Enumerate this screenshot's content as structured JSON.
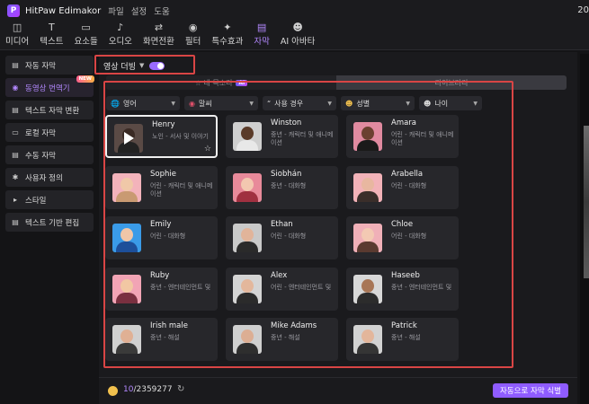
{
  "app": {
    "title": "HitPaw Edimakor",
    "menu": [
      "파일",
      "설정",
      "도움"
    ],
    "corner_text": "20"
  },
  "toolbar": {
    "items": [
      {
        "label": "미디어",
        "icon": "media-icon"
      },
      {
        "label": "텍스트",
        "icon": "text-icon"
      },
      {
        "label": "요소들",
        "icon": "elements-icon"
      },
      {
        "label": "오디오",
        "icon": "audio-icon"
      },
      {
        "label": "화면전환",
        "icon": "transition-icon"
      },
      {
        "label": "필터",
        "icon": "filter-icon"
      },
      {
        "label": "특수효과",
        "icon": "effects-icon"
      },
      {
        "label": "자막",
        "icon": "subtitle-icon"
      },
      {
        "label": "AI 아바타",
        "icon": "avatar-icon"
      }
    ],
    "active_index": 7
  },
  "sidebar": {
    "items": [
      {
        "label": "자동 자막",
        "icon": "cc-icon"
      },
      {
        "label": "동영상 번역기",
        "icon": "translate-icon",
        "badge": "NEW"
      },
      {
        "label": "텍스트 자막 변환",
        "icon": "text-to-subtitle-icon"
      },
      {
        "label": "로컬 자막",
        "icon": "local-subtitle-icon"
      },
      {
        "label": "수동 자막",
        "icon": "manual-subtitle-icon"
      },
      {
        "label": "사용자 정의",
        "icon": "custom-icon"
      },
      {
        "label": "스타일",
        "icon": "caret-right-icon"
      },
      {
        "label": "텍스트 기반 편집",
        "icon": "text-edit-icon"
      }
    ],
    "active_index": 1
  },
  "dubbing": {
    "label": "영상 더빙",
    "enabled": true
  },
  "tabs": {
    "my_voice": "내 목소리",
    "ai_badge": "AI",
    "library": "라이브러리"
  },
  "filters": [
    {
      "label": "영어",
      "icon": "globe-icon"
    },
    {
      "label": "말씨",
      "icon": "lips-icon"
    },
    {
      "label": "사용 경우",
      "icon": "quote-icon"
    },
    {
      "label": "성별",
      "icon": "gender-icon"
    },
    {
      "label": "나이",
      "icon": "age-icon"
    }
  ],
  "voices": [
    {
      "name": "Henry",
      "desc": "노인 - 서사 및 이야기",
      "selected": true,
      "skin": "#3a2a24",
      "bg": "#5a4a45",
      "shirt": "#222"
    },
    {
      "name": "Winston",
      "desc": "중년 - 캐릭터 및 애니메이션",
      "skin": "#5a3a28",
      "bg": "#cfcfcf",
      "shirt": "#e8e8e8"
    },
    {
      "name": "Amara",
      "desc": "어린 - 캐릭터 및 애니메이션",
      "skin": "#6b4030",
      "bg": "#e08aa0",
      "shirt": "#1a1a1a"
    },
    {
      "name": "Sophie",
      "desc": "어린 - 캐릭터 및 애니메이션",
      "skin": "#f0c8a8",
      "bg": "#f3b3bb",
      "shirt": "#c99a72"
    },
    {
      "name": "Siobhán",
      "desc": "중년 - 대화형",
      "skin": "#f3c7b0",
      "bg": "#e88a9a",
      "shirt": "#a03040"
    },
    {
      "name": "Arabella",
      "desc": "어린 - 대화형",
      "skin": "#e8b7a0",
      "bg": "#f2b2b8",
      "shirt": "#3a2e2a"
    },
    {
      "name": "Emily",
      "desc": "어린 - 대화형",
      "skin": "#f0c6a8",
      "bg": "#3a9be8",
      "shirt": "#1d4f9a"
    },
    {
      "name": "Ethan",
      "desc": "어린 - 대화형",
      "skin": "#e1b49a",
      "bg": "#c9c9c9",
      "shirt": "#2a2a2a"
    },
    {
      "name": "Chloe",
      "desc": "어린 - 대화형",
      "skin": "#f3c9b3",
      "bg": "#f0b0b8",
      "shirt": "#5a3a30"
    },
    {
      "name": "Ruby",
      "desc": "중년 - 엔터테인먼트 및",
      "skin": "#f2c7a3",
      "bg": "#f2a4b5",
      "shirt": "#7a3040"
    },
    {
      "name": "Alex",
      "desc": "어린 - 엔터테인먼트 및",
      "skin": "#e3b79c",
      "bg": "#d4d4d4",
      "shirt": "#2b2b2b"
    },
    {
      "name": "Haseeb",
      "desc": "중년 - 엔터테인먼트 및",
      "skin": "#a87656",
      "bg": "#d8d8d8",
      "shirt": "#2c2c2c"
    },
    {
      "name": "Irish male",
      "desc": "중년 - 해설",
      "skin": "#e0b094",
      "bg": "#d0d0d0",
      "shirt": "#3a3a3a"
    },
    {
      "name": "Mike Adams",
      "desc": "중년 - 해설",
      "skin": "#dcae93",
      "bg": "#cfcfcf",
      "shirt": "#2e2e2e"
    },
    {
      "name": "Patrick",
      "desc": "중년 - 해설",
      "skin": "#e3b69b",
      "bg": "#d2d2d2",
      "shirt": "#353535"
    }
  ],
  "footer": {
    "credits_used": "10",
    "credits_total": "/2359277",
    "auto_button": "자동으로 자막 식별"
  },
  "colors": {
    "accent": "#b388ff",
    "button": "#8f5cff",
    "highlight_box": "#d94545"
  }
}
